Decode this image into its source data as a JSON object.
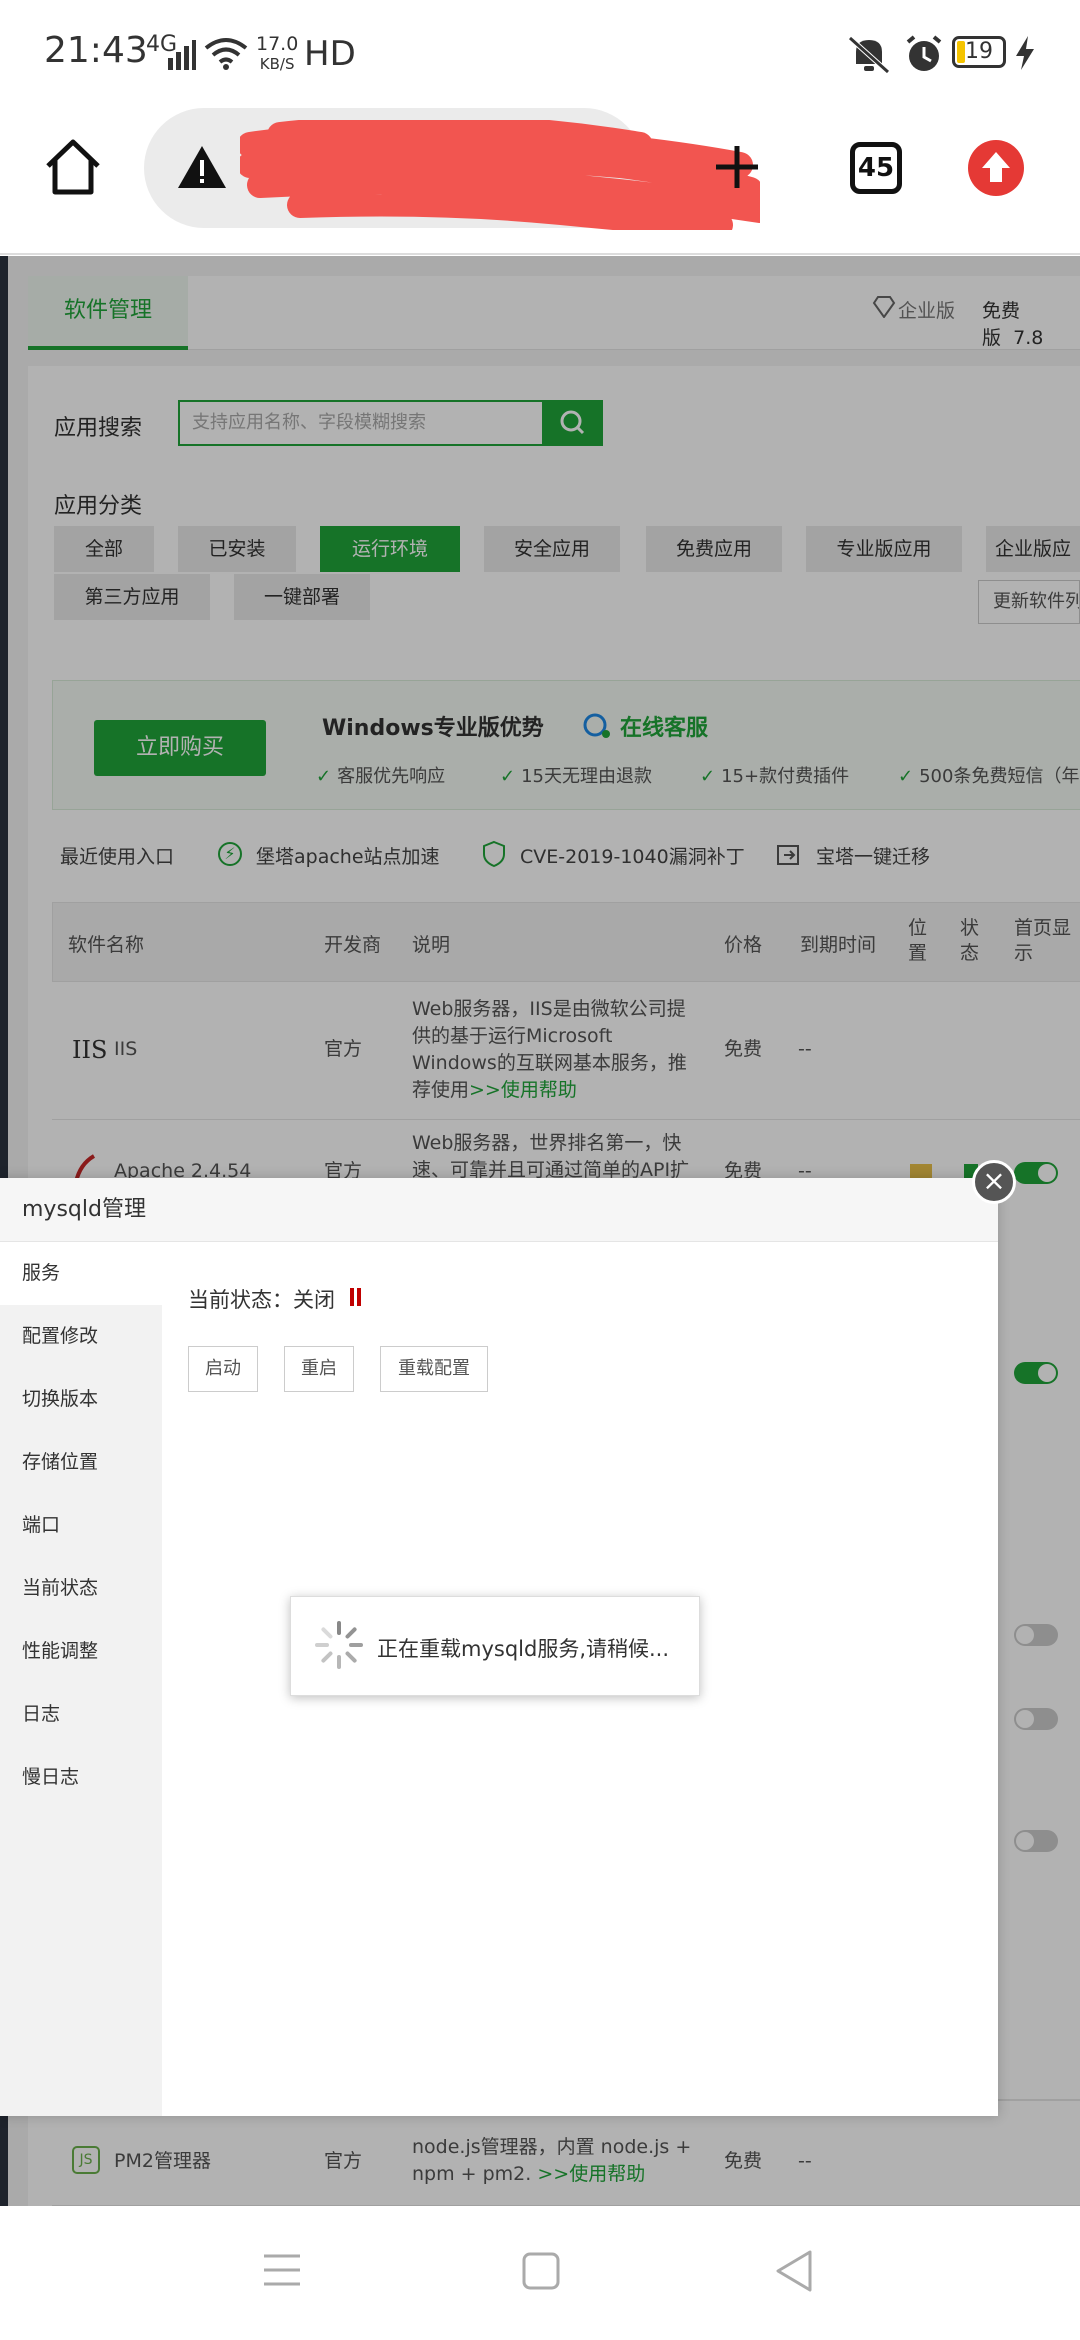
{
  "status_bar": {
    "time": "21:43",
    "network": "4G",
    "speed_value": "17.0",
    "speed_unit": "KB/S",
    "hd": "HD",
    "battery": "19",
    "icons": [
      "signal-icon",
      "wifi-icon",
      "mute-icon",
      "alarm-icon",
      "battery-icon",
      "charging-icon"
    ]
  },
  "browser": {
    "tab_count": "45",
    "icons": [
      "home-icon",
      "warning-icon",
      "new-tab-icon",
      "tabs-icon",
      "update-icon"
    ]
  },
  "panel": {
    "tab_label": "软件管理",
    "edition_enterprise": "企业版",
    "edition_free": "免费版",
    "version": "7.8",
    "search_label": "应用搜索",
    "search_placeholder": "支持应用名称、字段模糊搜索",
    "category_label": "应用分类",
    "categories": [
      "全部",
      "已安装",
      "运行环境",
      "安全应用",
      "免费应用",
      "专业版应用",
      "企业版应",
      "第三方应用",
      "一键部署"
    ],
    "active_category": "运行环境",
    "update_list": "更新软件列",
    "promo_buy": "立即购买",
    "promo_title": "Windows专业版优势",
    "promo_service": "在线客服",
    "perks": [
      "客服优先响应",
      "15天无理由退款",
      "15+款付费插件",
      "500条免费短信（年"
    ],
    "recent_label": "最近使用入口",
    "recent_items": [
      "堡塔apache站点加速",
      "CVE-2019-1040漏洞补丁",
      "宝塔一键迁移"
    ],
    "table_headers": [
      "软件名称",
      "开发商",
      "说明",
      "价格",
      "到期时间",
      "位置",
      "状态",
      "首页显示"
    ],
    "rows": [
      {
        "logo": "IIS",
        "name": "IIS",
        "dev": "官方",
        "desc": "Web服务器，IIS是由微软公司提供的基于运行Microsoft Windows的互联网基本服务，推荐使用",
        "help": ">>使用帮助",
        "price": "免费",
        "expire": "--"
      },
      {
        "name": "Apache 2.4.54",
        "dev": "官方",
        "desc": "Web服务器，世界排名第一，快速、可靠并且可通过简单的API扩",
        "price": "免费",
        "expire": "--"
      },
      {
        "name": "PM2管理器",
        "dev": "官方",
        "desc": "node.js管理器，内置 node.js + npm + pm2.",
        "help": ">>使用帮助",
        "price": "免费",
        "expire": "--"
      }
    ]
  },
  "modal": {
    "title": "mysqld管理",
    "menu": [
      "服务",
      "配置修改",
      "切换版本",
      "存储位置",
      "端口",
      "当前状态",
      "性能调整",
      "日志",
      "慢日志"
    ],
    "status_label": "当前状态：关闭",
    "buttons": [
      "启动",
      "重启",
      "重载配置"
    ],
    "loading_text": "正在重载mysqld服务,请稍候..."
  },
  "colors": {
    "accent": "#20a53a",
    "danger": "#e53935",
    "stop": "#c00000"
  }
}
